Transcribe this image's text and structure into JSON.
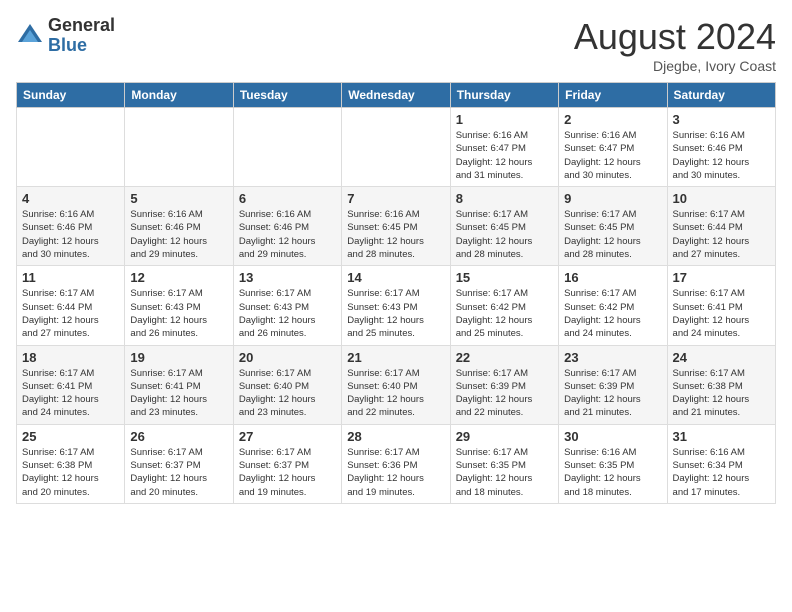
{
  "logo": {
    "general": "General",
    "blue": "Blue"
  },
  "title": {
    "month": "August 2024",
    "location": "Djegbe, Ivory Coast"
  },
  "weekdays": [
    "Sunday",
    "Monday",
    "Tuesday",
    "Wednesday",
    "Thursday",
    "Friday",
    "Saturday"
  ],
  "weeks": [
    [
      {
        "day": "",
        "info": ""
      },
      {
        "day": "",
        "info": ""
      },
      {
        "day": "",
        "info": ""
      },
      {
        "day": "",
        "info": ""
      },
      {
        "day": "1",
        "info": "Sunrise: 6:16 AM\nSunset: 6:47 PM\nDaylight: 12 hours\nand 31 minutes."
      },
      {
        "day": "2",
        "info": "Sunrise: 6:16 AM\nSunset: 6:47 PM\nDaylight: 12 hours\nand 30 minutes."
      },
      {
        "day": "3",
        "info": "Sunrise: 6:16 AM\nSunset: 6:46 PM\nDaylight: 12 hours\nand 30 minutes."
      }
    ],
    [
      {
        "day": "4",
        "info": "Sunrise: 6:16 AM\nSunset: 6:46 PM\nDaylight: 12 hours\nand 30 minutes."
      },
      {
        "day": "5",
        "info": "Sunrise: 6:16 AM\nSunset: 6:46 PM\nDaylight: 12 hours\nand 29 minutes."
      },
      {
        "day": "6",
        "info": "Sunrise: 6:16 AM\nSunset: 6:46 PM\nDaylight: 12 hours\nand 29 minutes."
      },
      {
        "day": "7",
        "info": "Sunrise: 6:16 AM\nSunset: 6:45 PM\nDaylight: 12 hours\nand 28 minutes."
      },
      {
        "day": "8",
        "info": "Sunrise: 6:17 AM\nSunset: 6:45 PM\nDaylight: 12 hours\nand 28 minutes."
      },
      {
        "day": "9",
        "info": "Sunrise: 6:17 AM\nSunset: 6:45 PM\nDaylight: 12 hours\nand 28 minutes."
      },
      {
        "day": "10",
        "info": "Sunrise: 6:17 AM\nSunset: 6:44 PM\nDaylight: 12 hours\nand 27 minutes."
      }
    ],
    [
      {
        "day": "11",
        "info": "Sunrise: 6:17 AM\nSunset: 6:44 PM\nDaylight: 12 hours\nand 27 minutes."
      },
      {
        "day": "12",
        "info": "Sunrise: 6:17 AM\nSunset: 6:43 PM\nDaylight: 12 hours\nand 26 minutes."
      },
      {
        "day": "13",
        "info": "Sunrise: 6:17 AM\nSunset: 6:43 PM\nDaylight: 12 hours\nand 26 minutes."
      },
      {
        "day": "14",
        "info": "Sunrise: 6:17 AM\nSunset: 6:43 PM\nDaylight: 12 hours\nand 25 minutes."
      },
      {
        "day": "15",
        "info": "Sunrise: 6:17 AM\nSunset: 6:42 PM\nDaylight: 12 hours\nand 25 minutes."
      },
      {
        "day": "16",
        "info": "Sunrise: 6:17 AM\nSunset: 6:42 PM\nDaylight: 12 hours\nand 24 minutes."
      },
      {
        "day": "17",
        "info": "Sunrise: 6:17 AM\nSunset: 6:41 PM\nDaylight: 12 hours\nand 24 minutes."
      }
    ],
    [
      {
        "day": "18",
        "info": "Sunrise: 6:17 AM\nSunset: 6:41 PM\nDaylight: 12 hours\nand 24 minutes."
      },
      {
        "day": "19",
        "info": "Sunrise: 6:17 AM\nSunset: 6:41 PM\nDaylight: 12 hours\nand 23 minutes."
      },
      {
        "day": "20",
        "info": "Sunrise: 6:17 AM\nSunset: 6:40 PM\nDaylight: 12 hours\nand 23 minutes."
      },
      {
        "day": "21",
        "info": "Sunrise: 6:17 AM\nSunset: 6:40 PM\nDaylight: 12 hours\nand 22 minutes."
      },
      {
        "day": "22",
        "info": "Sunrise: 6:17 AM\nSunset: 6:39 PM\nDaylight: 12 hours\nand 22 minutes."
      },
      {
        "day": "23",
        "info": "Sunrise: 6:17 AM\nSunset: 6:39 PM\nDaylight: 12 hours\nand 21 minutes."
      },
      {
        "day": "24",
        "info": "Sunrise: 6:17 AM\nSunset: 6:38 PM\nDaylight: 12 hours\nand 21 minutes."
      }
    ],
    [
      {
        "day": "25",
        "info": "Sunrise: 6:17 AM\nSunset: 6:38 PM\nDaylight: 12 hours\nand 20 minutes."
      },
      {
        "day": "26",
        "info": "Sunrise: 6:17 AM\nSunset: 6:37 PM\nDaylight: 12 hours\nand 20 minutes."
      },
      {
        "day": "27",
        "info": "Sunrise: 6:17 AM\nSunset: 6:37 PM\nDaylight: 12 hours\nand 19 minutes."
      },
      {
        "day": "28",
        "info": "Sunrise: 6:17 AM\nSunset: 6:36 PM\nDaylight: 12 hours\nand 19 minutes."
      },
      {
        "day": "29",
        "info": "Sunrise: 6:17 AM\nSunset: 6:35 PM\nDaylight: 12 hours\nand 18 minutes."
      },
      {
        "day": "30",
        "info": "Sunrise: 6:16 AM\nSunset: 6:35 PM\nDaylight: 12 hours\nand 18 minutes."
      },
      {
        "day": "31",
        "info": "Sunrise: 6:16 AM\nSunset: 6:34 PM\nDaylight: 12 hours\nand 17 minutes."
      }
    ]
  ]
}
